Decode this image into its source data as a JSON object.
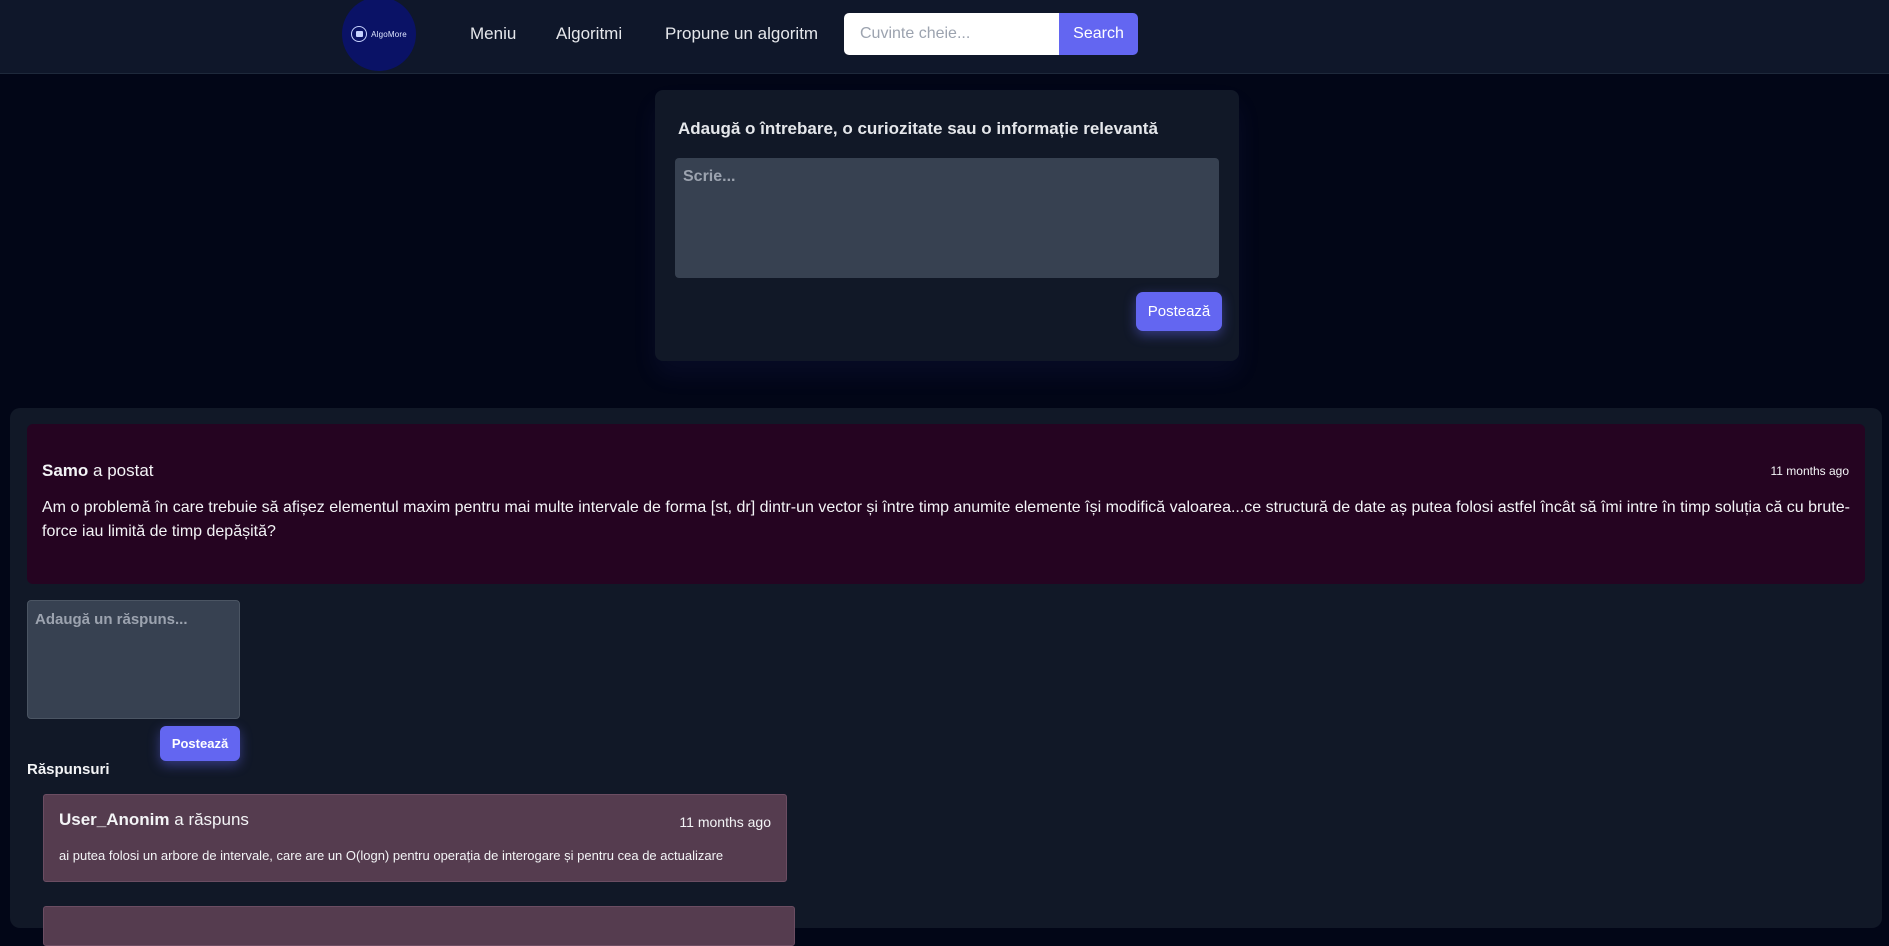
{
  "navbar": {
    "logo_text": "AlgoMore",
    "links": [
      "Meniu",
      "Algoritmi",
      "Propune un algoritm"
    ],
    "search_placeholder": "Cuvinte cheie...",
    "search_label": "Search"
  },
  "composer": {
    "title": "Adaugă o întrebare, o curiozitate sau o informație relevantă",
    "placeholder": "Scrie...",
    "post_label": "Postează"
  },
  "post": {
    "author": "Samo",
    "action": "a postat",
    "time": "11 months ago",
    "body": "Am o problemă în care trebuie să afișez elementul maxim pentru mai multe intervale de forma [st, dr] dintr-un vector și între timp anumite elemente își modifică valoarea...ce structură de date aș putea folosi astfel încât să îmi intre în timp soluția că cu brute-force iau limită de timp depășită?",
    "reply_placeholder": "Adaugă un răspuns...",
    "reply_post_label": "Postează",
    "answers_heading": "Răspunsuri",
    "answers": [
      {
        "author": "User_Anonim",
        "action": "a răspuns",
        "time": "11 months ago",
        "body": "ai putea folosi un arbore de intervale, care are un O(logn) pentru operația de interogare și pentru cea de actualizare"
      }
    ]
  },
  "colors": {
    "background": "#020617",
    "navbar": "#0f172a",
    "accent": "#6366f1",
    "post_bg": "#250421",
    "answer_bg": "#553c4f"
  }
}
